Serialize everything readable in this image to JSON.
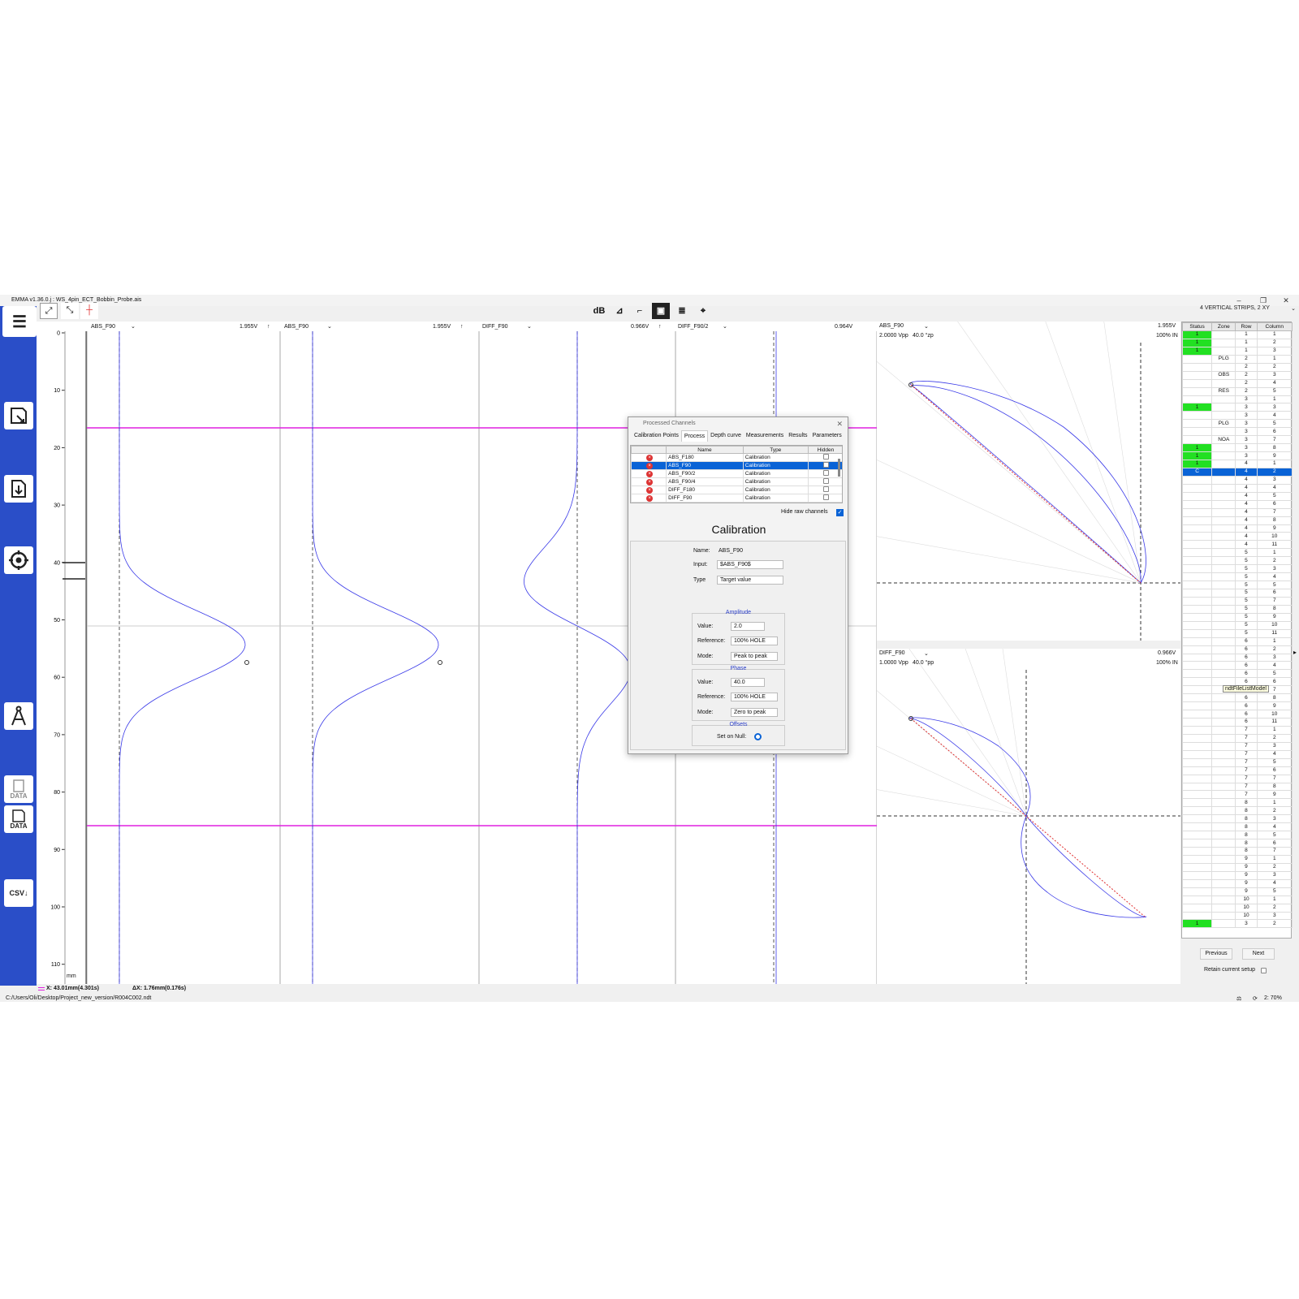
{
  "window": {
    "title": "EMMA v1.36.0.j : WS_4pin_ECT_Bobbin_Probe.ais",
    "layout_select": "4 VERTICAL STRIPS, 2 XY"
  },
  "toolbar": {
    "db_label": "dB"
  },
  "strips": [
    {
      "channel": "ABS_F90",
      "scale": "1.955V"
    },
    {
      "channel": "ABS_F90",
      "scale": "1.955V"
    },
    {
      "channel": "DIFF_F90",
      "scale": "0.966V"
    },
    {
      "channel": "DIFF_F90/2",
      "scale": "0.964V"
    }
  ],
  "axis": {
    "ticks": [
      "0",
      "10",
      "20",
      "30",
      "40",
      "50",
      "60",
      "70",
      "80",
      "90",
      "100",
      "110"
    ],
    "unit": "mm"
  },
  "xy_top": {
    "channel": "ABS_F90",
    "scale": "1.955V",
    "vpp": "2.0000 Vpp",
    "angle": "40.0 °zp",
    "pct": "100% IN"
  },
  "xy_bottom": {
    "channel": "DIFF_F90",
    "scale": "0.966V",
    "vpp": "1.0000 Vpp",
    "angle": "40.0 °pp",
    "pct": "100% IN"
  },
  "grid": {
    "headers": [
      "Status",
      "Zone",
      "Row",
      "Column"
    ],
    "rows": [
      {
        "s": "1",
        "z": "",
        "r": "1",
        "c": "1",
        "g": true
      },
      {
        "s": "1",
        "z": "",
        "r": "1",
        "c": "2",
        "g": true
      },
      {
        "s": "1",
        "z": "",
        "r": "1",
        "c": "3",
        "g": true
      },
      {
        "s": "",
        "z": "PLG",
        "r": "2",
        "c": "1"
      },
      {
        "s": "",
        "z": "",
        "r": "2",
        "c": "2"
      },
      {
        "s": "",
        "z": "OBS",
        "r": "2",
        "c": "3"
      },
      {
        "s": "",
        "z": "",
        "r": "2",
        "c": "4"
      },
      {
        "s": "",
        "z": "RES",
        "r": "2",
        "c": "5"
      },
      {
        "s": "",
        "z": "",
        "r": "3",
        "c": "1"
      },
      {
        "s": "1",
        "z": "",
        "r": "3",
        "c": "3",
        "g": true
      },
      {
        "s": "",
        "z": "",
        "r": "3",
        "c": "4"
      },
      {
        "s": "",
        "z": "PLG",
        "r": "3",
        "c": "5"
      },
      {
        "s": "",
        "z": "",
        "r": "3",
        "c": "6"
      },
      {
        "s": "",
        "z": "NOA",
        "r": "3",
        "c": "7"
      },
      {
        "s": "1",
        "z": "",
        "r": "3",
        "c": "8",
        "g": true
      },
      {
        "s": "1",
        "z": "",
        "r": "3",
        "c": "9",
        "g": true
      },
      {
        "s": "1",
        "z": "",
        "r": "4",
        "c": "1",
        "g": true
      },
      {
        "s": "C",
        "z": "",
        "r": "4",
        "c": "2",
        "sel": true
      },
      {
        "s": "",
        "z": "",
        "r": "4",
        "c": "3"
      },
      {
        "s": "",
        "z": "",
        "r": "4",
        "c": "4"
      },
      {
        "s": "",
        "z": "",
        "r": "4",
        "c": "5"
      },
      {
        "s": "",
        "z": "",
        "r": "4",
        "c": "6"
      },
      {
        "s": "",
        "z": "",
        "r": "4",
        "c": "7"
      },
      {
        "s": "",
        "z": "",
        "r": "4",
        "c": "8"
      },
      {
        "s": "",
        "z": "",
        "r": "4",
        "c": "9"
      },
      {
        "s": "",
        "z": "",
        "r": "4",
        "c": "10"
      },
      {
        "s": "",
        "z": "",
        "r": "4",
        "c": "11"
      },
      {
        "s": "",
        "z": "",
        "r": "5",
        "c": "1"
      },
      {
        "s": "",
        "z": "",
        "r": "5",
        "c": "2"
      },
      {
        "s": "",
        "z": "",
        "r": "5",
        "c": "3"
      },
      {
        "s": "",
        "z": "",
        "r": "5",
        "c": "4"
      },
      {
        "s": "",
        "z": "",
        "r": "5",
        "c": "5"
      },
      {
        "s": "",
        "z": "",
        "r": "5",
        "c": "6"
      },
      {
        "s": "",
        "z": "",
        "r": "5",
        "c": "7"
      },
      {
        "s": "",
        "z": "",
        "r": "5",
        "c": "8"
      },
      {
        "s": "",
        "z": "",
        "r": "5",
        "c": "9"
      },
      {
        "s": "",
        "z": "",
        "r": "5",
        "c": "10"
      },
      {
        "s": "",
        "z": "",
        "r": "5",
        "c": "11"
      },
      {
        "s": "",
        "z": "",
        "r": "6",
        "c": "1"
      },
      {
        "s": "",
        "z": "",
        "r": "6",
        "c": "2"
      },
      {
        "s": "",
        "z": "",
        "r": "6",
        "c": "3"
      },
      {
        "s": "",
        "z": "",
        "r": "6",
        "c": "4"
      },
      {
        "s": "",
        "z": "",
        "r": "6",
        "c": "5"
      },
      {
        "s": "",
        "z": "",
        "r": "6",
        "c": "6"
      },
      {
        "s": "",
        "z": "",
        "r": "6",
        "c": "7"
      },
      {
        "s": "",
        "z": "",
        "r": "6",
        "c": "8"
      },
      {
        "s": "",
        "z": "",
        "r": "6",
        "c": "9"
      },
      {
        "s": "",
        "z": "",
        "r": "6",
        "c": "10"
      },
      {
        "s": "",
        "z": "",
        "r": "6",
        "c": "11"
      },
      {
        "s": "",
        "z": "",
        "r": "7",
        "c": "1"
      },
      {
        "s": "",
        "z": "",
        "r": "7",
        "c": "2"
      },
      {
        "s": "",
        "z": "",
        "r": "7",
        "c": "3"
      },
      {
        "s": "",
        "z": "",
        "r": "7",
        "c": "4"
      },
      {
        "s": "",
        "z": "",
        "r": "7",
        "c": "5"
      },
      {
        "s": "",
        "z": "",
        "r": "7",
        "c": "6"
      },
      {
        "s": "",
        "z": "",
        "r": "7",
        "c": "7"
      },
      {
        "s": "",
        "z": "",
        "r": "7",
        "c": "8"
      },
      {
        "s": "",
        "z": "",
        "r": "7",
        "c": "9"
      },
      {
        "s": "",
        "z": "",
        "r": "8",
        "c": "1"
      },
      {
        "s": "",
        "z": "",
        "r": "8",
        "c": "2"
      },
      {
        "s": "",
        "z": "",
        "r": "8",
        "c": "3"
      },
      {
        "s": "",
        "z": "",
        "r": "8",
        "c": "4"
      },
      {
        "s": "",
        "z": "",
        "r": "8",
        "c": "5"
      },
      {
        "s": "",
        "z": "",
        "r": "8",
        "c": "6"
      },
      {
        "s": "",
        "z": "",
        "r": "8",
        "c": "7"
      },
      {
        "s": "",
        "z": "",
        "r": "9",
        "c": "1"
      },
      {
        "s": "",
        "z": "",
        "r": "9",
        "c": "2"
      },
      {
        "s": "",
        "z": "",
        "r": "9",
        "c": "3"
      },
      {
        "s": "",
        "z": "",
        "r": "9",
        "c": "4"
      },
      {
        "s": "",
        "z": "",
        "r": "9",
        "c": "5"
      },
      {
        "s": "",
        "z": "",
        "r": "10",
        "c": "1"
      },
      {
        "s": "",
        "z": "",
        "r": "10",
        "c": "2"
      },
      {
        "s": "",
        "z": "",
        "r": "10",
        "c": "3"
      },
      {
        "s": "1",
        "z": "",
        "r": "3",
        "c": "2",
        "g": true
      }
    ],
    "tooltip": "ndtFileListModel",
    "previous": "Previous",
    "next": "Next",
    "retain": "Retain current setup"
  },
  "status": {
    "x_readout": "X: 43.01mm(4.301s)",
    "dx_readout": "ΔX: 1.76mm(0.176s)",
    "path": "C:/Users/Oli/Desktop/Project_new_version/R004C002.ndt",
    "battery": "2:  70%"
  },
  "dialog": {
    "title": "Processed Channels",
    "tabs": [
      "Calibration Points",
      "Process",
      "Depth curve",
      "Measurements",
      "Results",
      "Parameters"
    ],
    "active_tab": "Process",
    "columns": [
      "Name",
      "Type",
      "Hidden"
    ],
    "channels": [
      {
        "name": "ABS_F180",
        "type": "Calibration"
      },
      {
        "name": "ABS_F90",
        "type": "Calibration",
        "sel": true
      },
      {
        "name": "ABS_F90/2",
        "type": "Calibration"
      },
      {
        "name": "ABS_F90/4",
        "type": "Calibration"
      },
      {
        "name": "DIFF_F180",
        "type": "Calibration"
      },
      {
        "name": "DIFF_F90",
        "type": "Calibration"
      }
    ],
    "hide_raw": "Hide raw channels",
    "section_title": "Calibration",
    "name_label": "Name:",
    "name_value": "ABS_F90",
    "input_label": "Input:",
    "input_value": "$ABS_F90$",
    "type_label": "Type",
    "type_value": "Target value",
    "amplitude": {
      "title": "Amplitude",
      "value_label": "Value:",
      "value": "2.0",
      "ref_label": "Reference:",
      "ref": "100% HOLE",
      "mode_label": "Mode:",
      "mode": "Peak to peak"
    },
    "phase": {
      "title": "Phase",
      "value_label": "Value:",
      "value": "40.0",
      "ref_label": "Reference:",
      "ref": "100% HOLE",
      "mode_label": "Mode:",
      "mode": "Zero to peak"
    },
    "offsets": {
      "title": "Offsets",
      "null_label": "Set on Null:"
    }
  },
  "colors": {
    "sidebar": "#2a4ec8",
    "signal": "#3a3ae8",
    "marker": "#e020e0",
    "selection": "#0a63d6",
    "status_ok": "#22e022"
  }
}
